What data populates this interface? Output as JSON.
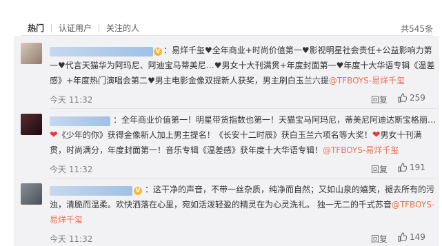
{
  "tabs": {
    "items": [
      {
        "label": "热门"
      },
      {
        "label": "认证用户"
      },
      {
        "label": "关注的人"
      }
    ],
    "count_label": "共545条"
  },
  "comments": [
    {
      "text_prefix": "：易烊千玺",
      "text_main": "全年商业+时尚价值第一",
      "text_b": "影视明星社会责任+公益影响力第一",
      "text_c": "代言天猫华为阿玛尼、阿迪宝马蒂美尼…",
      "text_d": "男女十大刊满贯+年度封面第一",
      "text_e": "年度十大华语专辑《温差感》+年度热门演唱会第二",
      "text_f": "男主电影金像双提新人获奖，男主刷白玉兰六提",
      "mention": "@TFBOYS-易烊千玺",
      "time": "今天 11:32",
      "reply": "回复",
      "likes": "259",
      "avatar_color": "#b9a89a"
    },
    {
      "text_a": "：全年商业价值第一！明星带货指数也第一！天猫宝马阿玛尼，蒂美尼阿迪达斯宝格丽…",
      "text_b": "《少年的你》获得金像新人加上男主提名！《长安十二时辰》获白玉兰六项名等大奖！",
      "text_c": "男女十刊满贯，时尚满分，年度封面第一！音乐专辑《温差感》获年度十大华语专辑！",
      "mention": "@TFBOYS-易烊千玺",
      "time": "今天 11:32",
      "reply": "回复",
      "likes": "191",
      "avatar_color": "#3a1a1f"
    },
    {
      "text_a": "：这干净的声音，不带一丝杂质，纯净而自然；又如山泉的嬉笑，褪去所有的污浊，清脆而温柔。欢快洒落在心里，宛如活泼轻盈的精灵在为心灵洗礼。 独一无二的千式苏音",
      "mention": "@TFBOYS-易烊千玺",
      "time": "今天 11:32",
      "reply": "回复",
      "likes": "149",
      "avatar_color": "#6d7078"
    }
  ],
  "colors": {
    "mention": "#eb7350",
    "list_bg": "#f2f2f5",
    "nick_blue": "#9fc0e6",
    "vip_badge": "#f6b73c",
    "red_heart": "#e53935"
  },
  "icons": {
    "like": "thumb-up-icon",
    "heart": "heart-icon",
    "vip": "vip-badge-icon"
  }
}
